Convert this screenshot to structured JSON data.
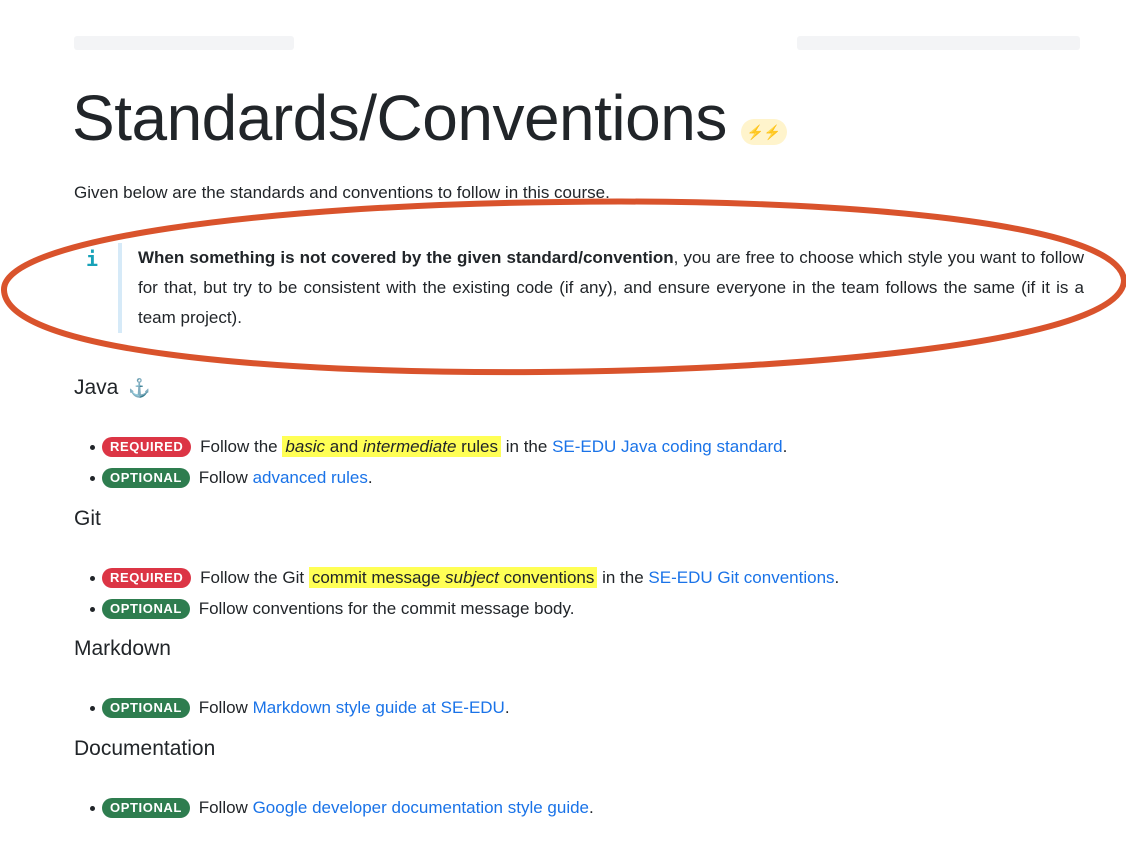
{
  "page": {
    "title": "Standards/Conventions",
    "title_badge_icon": "bolt-icon",
    "intro": "Given below are the standards and conventions to follow in this course."
  },
  "note": {
    "icon": "info-icon",
    "bold": "When something is not covered by the given standard/convention",
    "text": ", you are free to choose which style you want to follow for that, but try to be consistent with the existing code (if any), and ensure everyone in the team follows the same (if it is a team project)."
  },
  "annotation": {
    "color": "#d9532c"
  },
  "colors": {
    "required": "#dc3545",
    "optional": "#2e7d4f",
    "link": "#1a73e8",
    "highlight": "#ffff55"
  },
  "labels": {
    "required": "REQUIRED",
    "optional": "OPTIONAL"
  },
  "sections": {
    "java": {
      "heading": "Java",
      "anchor_icon": "anchor-icon",
      "items": [
        {
          "pre": "Follow the",
          "hl_em1": "basic",
          "hl_mid": " and ",
          "hl_em2": "intermediate",
          "hl_post": " rules",
          "mid": " in the ",
          "link": "SE-EDU Java coding standard",
          "post": "."
        },
        {
          "pre": "Follow ",
          "link": "advanced rules",
          "post": "."
        }
      ]
    },
    "git": {
      "heading": "Git",
      "items": [
        {
          "pre": "Follow the Git",
          "hl_pre": "commit message ",
          "hl_em": "subject",
          "hl_post": " conventions",
          "mid": " in the ",
          "link": "SE-EDU Git conventions",
          "post": "."
        },
        {
          "pre": "Follow conventions for the commit message body."
        }
      ]
    },
    "markdown": {
      "heading": "Markdown",
      "items": [
        {
          "pre": "Follow ",
          "link": "Markdown style guide at SE-EDU",
          "post": "."
        }
      ]
    },
    "documentation": {
      "heading": "Documentation",
      "items": [
        {
          "pre": "Follow ",
          "link": "Google developer documentation style guide",
          "post": "."
        }
      ]
    }
  }
}
